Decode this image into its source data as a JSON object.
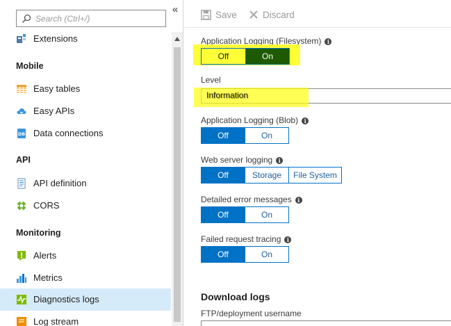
{
  "sidebar": {
    "search_placeholder": "Search (Ctrl+/)",
    "collapse_glyph": "«",
    "sections": {
      "mobile": "Mobile",
      "api": "API",
      "monitoring": "Monitoring"
    },
    "items": {
      "extensions": "Extensions",
      "easy_tables": "Easy tables",
      "easy_apis": "Easy APIs",
      "data_connections": "Data connections",
      "api_definition": "API definition",
      "cors": "CORS",
      "alerts": "Alerts",
      "metrics": "Metrics",
      "diagnostics_logs": "Diagnostics logs",
      "log_stream": "Log stream"
    },
    "selected_item": "Diagnostics logs"
  },
  "toolbar": {
    "save_label": "Save",
    "discard_label": "Discard"
  },
  "settings": {
    "app_logging_fs": {
      "label": "Application Logging (Filesystem)",
      "options": [
        "Off",
        "On"
      ],
      "selected": "On"
    },
    "level": {
      "label": "Level",
      "value": "Information"
    },
    "app_logging_blob": {
      "label": "Application Logging (Blob)",
      "options": [
        "Off",
        "On"
      ],
      "selected": "Off"
    },
    "web_server_logging": {
      "label": "Web server logging",
      "options": [
        "Off",
        "Storage",
        "File System"
      ],
      "selected": "Off"
    },
    "detailed_errors": {
      "label": "Detailed error messages",
      "options": [
        "Off",
        "On"
      ],
      "selected": "Off"
    },
    "failed_request_tracing": {
      "label": "Failed request tracing",
      "options": [
        "Off",
        "On"
      ],
      "selected": "Off"
    }
  },
  "download_logs": {
    "title": "Download logs",
    "ftp_username_label": "FTP/deployment username"
  },
  "colors": {
    "accent": "#0072c6",
    "highlight": "#ffff00",
    "selected_row": "#d6ebfa",
    "on_selected_dark": "#1e5a00"
  }
}
